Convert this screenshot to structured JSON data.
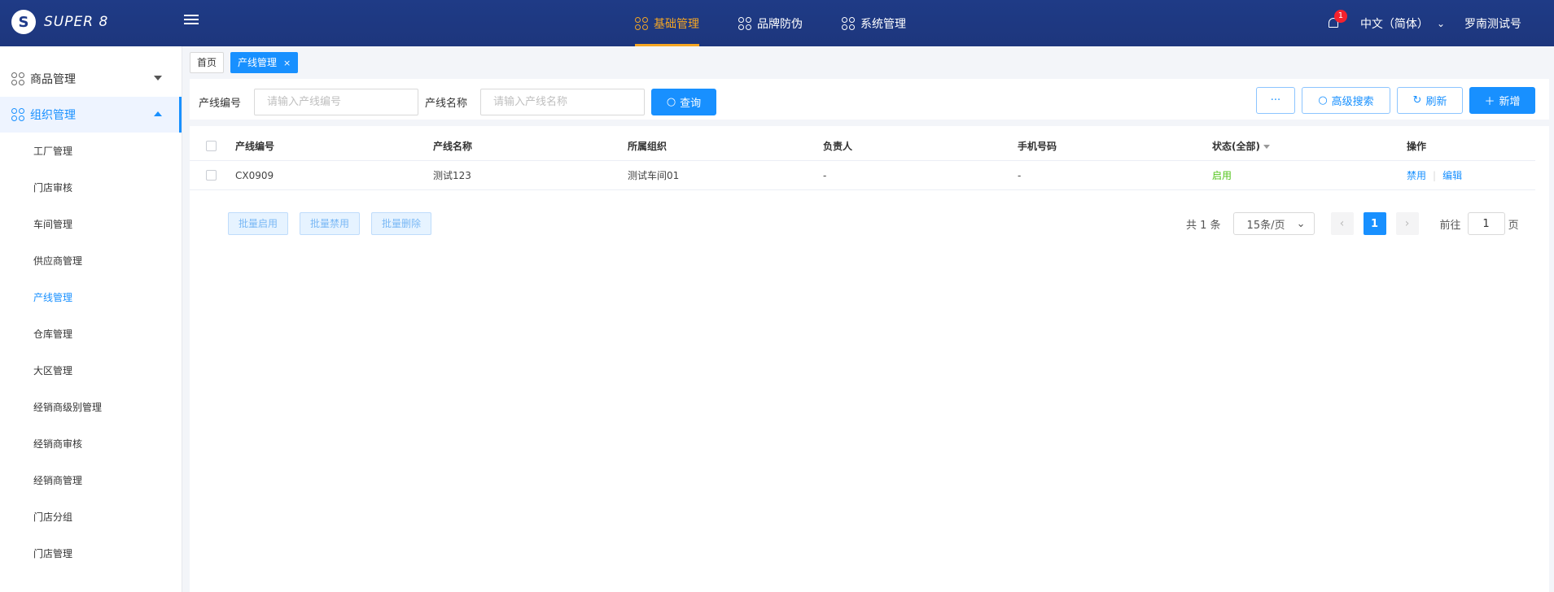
{
  "brand": {
    "name": "SUPER 8",
    "mark": "S"
  },
  "topnav": [
    {
      "label": "基础管理",
      "active": true
    },
    {
      "label": "品牌防伪",
      "active": false
    },
    {
      "label": "系统管理",
      "active": false
    }
  ],
  "header": {
    "notification_count": "1",
    "language": "中文（简体）",
    "user": "罗南测试号"
  },
  "sidebar": {
    "groups": [
      {
        "label": "商品管理",
        "open": false
      },
      {
        "label": "组织管理",
        "open": true
      }
    ],
    "sub_items": [
      {
        "label": "工厂管理"
      },
      {
        "label": "门店审核"
      },
      {
        "label": "车间管理"
      },
      {
        "label": "供应商管理"
      },
      {
        "label": "产线管理",
        "active": true
      },
      {
        "label": "仓库管理"
      },
      {
        "label": "大区管理"
      },
      {
        "label": "经销商级别管理"
      },
      {
        "label": "经销商审核"
      },
      {
        "label": "经销商管理"
      },
      {
        "label": "门店分组"
      },
      {
        "label": "门店管理"
      }
    ]
  },
  "tags": {
    "home": "首页",
    "current": "产线管理",
    "close": "×"
  },
  "search": {
    "code_label": "产线编号",
    "code_placeholder": "请输入产线编号",
    "name_label": "产线名称",
    "name_placeholder": "请输入产线名称",
    "query_button": "查询",
    "more_button": "···",
    "advanced_button": "高级搜索",
    "refresh_button": "刷新",
    "add_button": "新增"
  },
  "table": {
    "columns": [
      "产线编号",
      "产线名称",
      "所属组织",
      "负责人",
      "手机号码",
      "状态(全部)",
      "操作"
    ],
    "rows": [
      {
        "code": "CX0909",
        "name": "测试123",
        "org": "测试车间01",
        "owner": "-",
        "phone": "-",
        "status": "启用",
        "action_disable": "禁用",
        "action_edit": "编辑"
      }
    ]
  },
  "bulk": {
    "enable": "批量启用",
    "disable": "批量禁用",
    "delete": "批量删除"
  },
  "pagination": {
    "total": "共 1 条",
    "page_size": "15条/页",
    "current": "1",
    "goto_label": "前往",
    "goto_value": "1",
    "page_suffix": "页"
  },
  "colors": {
    "header_bg": "#1e3a8a",
    "accent": "#1890ff",
    "nav_active": "#f5a623",
    "status_on": "#52c41a",
    "badge": "#f5222d"
  }
}
